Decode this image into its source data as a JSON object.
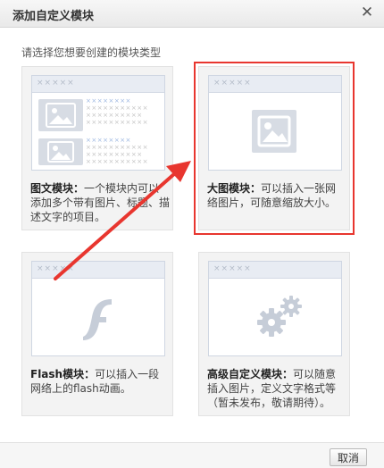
{
  "dialog": {
    "title": "添加自定义模块",
    "close_icon": "close-icon",
    "subtitle": "请选择您想要创建的模块类型",
    "cancel_label": "取消"
  },
  "thumb_placeholder": "×××××",
  "cards": [
    {
      "name": "图文模块：",
      "desc": "一个模块内可以添加多个带有图片、标题、描述文字的项目。",
      "icon": "image-text-icon"
    },
    {
      "name": "大图模块：",
      "desc": "可以插入一张网络图片，可随意缩放大小。",
      "icon": "image-icon",
      "selected": true
    },
    {
      "name": "Flash模块：",
      "desc": "可以插入一段网络上的flash动画。",
      "icon": "flash-icon"
    },
    {
      "name": "高级自定义模块：",
      "desc": "可以随意插入图片，定义文字格式等（暂未发布，敬请期待）。",
      "icon": "gears-icon"
    }
  ],
  "colors": {
    "highlight": "#e8362f",
    "arrow": "#e8362f",
    "icon_gray": "#c6cdd8"
  }
}
